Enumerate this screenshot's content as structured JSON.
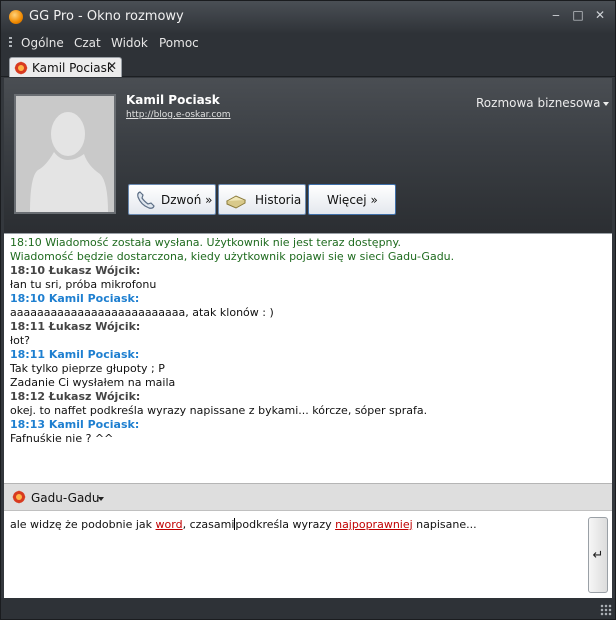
{
  "window": {
    "title": "GG Pro - Okno rozmowy",
    "controls": {
      "minimize": "‒",
      "maximize": "□",
      "close": "✕"
    }
  },
  "menu": {
    "items": [
      "Ogólne",
      "Czat",
      "Widok",
      "Pomoc"
    ]
  },
  "tab": {
    "label": "Kamil Pociask",
    "close": "✕"
  },
  "contact": {
    "name": "Kamil Pociask",
    "url": "http://blog.e-oskar.com",
    "mode": "Rozmowa biznesowa"
  },
  "buttons": {
    "call": "Dzwoń »",
    "history": "Historia",
    "more": "Więcej »"
  },
  "conversation": [
    {
      "type": "sys",
      "text": "18:10 Wiadomość została wysłana. Użytkownik nie jest teraz dostępny."
    },
    {
      "type": "sys",
      "text": "Wiadomość będzie dostarczona, kiedy użytkownik pojawi się w sieci Gadu-Gadu."
    },
    {
      "type": "who-other",
      "text": "18:10 Łukasz Wójcik:"
    },
    {
      "type": "msg",
      "text": "łan tu sri, próba mikrofonu"
    },
    {
      "type": "who-me",
      "text": "18:10 Kamil Pociask:"
    },
    {
      "type": "msg",
      "text": "aaaaaaaaaaaaaaaaaaaaaaaaaa, atak klonów : )"
    },
    {
      "type": "who-other",
      "text": "18:11 Łukasz Wójcik:"
    },
    {
      "type": "msg",
      "text": "łot?"
    },
    {
      "type": "who-me",
      "text": "18:11 Kamil Pociask:"
    },
    {
      "type": "msg",
      "text": "Tak tylko pieprze głupoty ; P"
    },
    {
      "type": "msg",
      "text": "Zadanie Ci wysłałem na maila"
    },
    {
      "type": "who-other",
      "text": "18:12 Łukasz Wójcik:"
    },
    {
      "type": "msg",
      "text": "okej. to naffet podkreśla wyrazy napissane z bykami... kórcze, sóper sprafa."
    },
    {
      "type": "who-me",
      "text": "18:13 Kamil Pociask:"
    },
    {
      "type": "msg",
      "text": "Fafnuśkie nie ? ^^"
    }
  ],
  "protocol": {
    "label": "Gadu-Gadu"
  },
  "input": {
    "part1": "ale widzę że podobnie jak ",
    "word1": "word",
    "part2": ", czasami",
    "part3": "podkreśla wyrazy ",
    "word2": "najpoprawniej",
    "part4": " napisane..."
  },
  "send": {
    "glyph": "↵"
  },
  "colors": {
    "system_message": "#1f6b1f",
    "own_nick": "#1e7fd0",
    "other_nick": "#444444",
    "misspelled": "#c00000"
  }
}
